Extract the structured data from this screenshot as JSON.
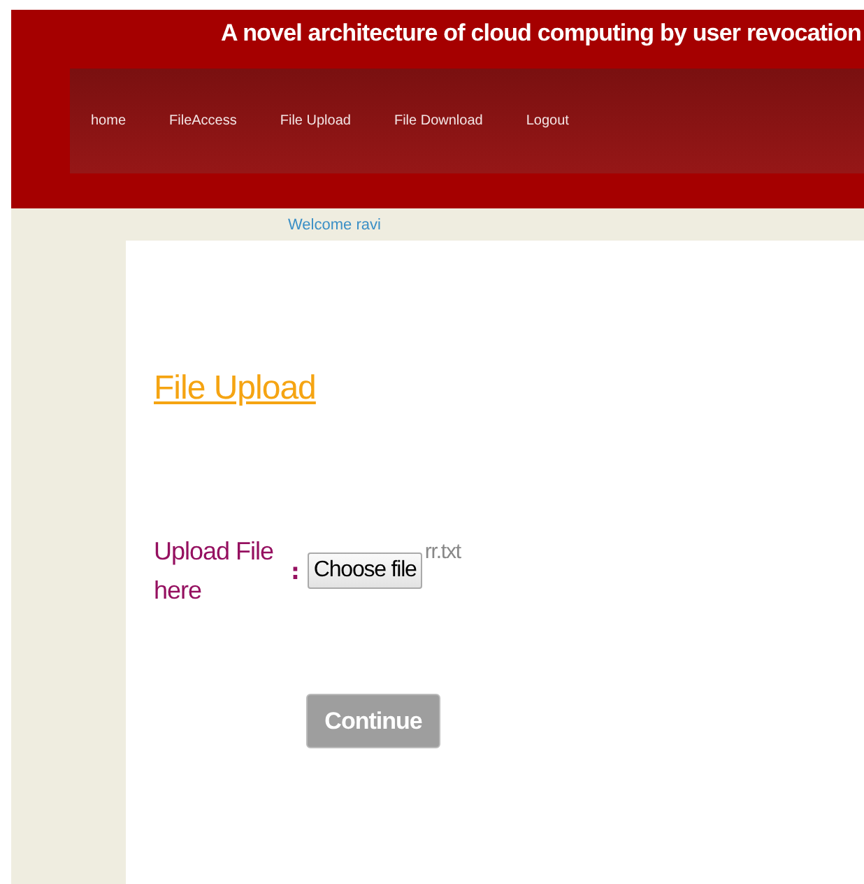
{
  "header": {
    "title": "A novel architecture of cloud computing by user revocation"
  },
  "nav": [
    {
      "label": "home"
    },
    {
      "label": "FileAccess"
    },
    {
      "label": "File Upload"
    },
    {
      "label": "File Download"
    },
    {
      "label": "Logout"
    }
  ],
  "welcome": "Welcome ravi",
  "heading": "File Upload",
  "form": {
    "label": "Upload File here",
    "separator": ":",
    "file_button": "Choose file",
    "file_name": "rr.txt",
    "submit": "Continue"
  }
}
